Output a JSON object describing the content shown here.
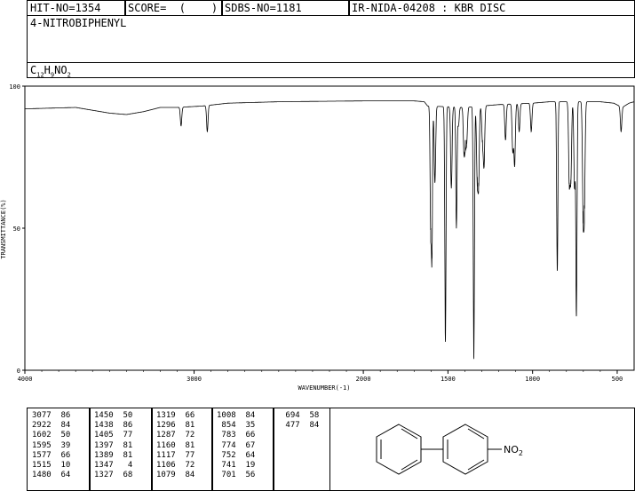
{
  "header": {
    "hit_no": "HIT-NO=1354",
    "score": "SCORE=  (    )",
    "sdbs_no": "SDBS-NO=1181",
    "ir": "IR-NIDA-04208 : KBR DISC",
    "compound": "4-NITROBIPHENYL",
    "formula_prefix": "C",
    "formula_sub1": "12",
    "formula_h": "H",
    "formula_sub2": "9",
    "formula_rest": "NO",
    "formula_sub3": "2"
  },
  "chart_data": {
    "type": "line",
    "xlabel": "WAVENUMBER(-1)",
    "ylabel": "TRANSMITTANCE(%)",
    "xlim": [
      4000,
      400
    ],
    "ylim": [
      0,
      100
    ],
    "x_ticks": [
      4000,
      3000,
      2000,
      1500,
      1000,
      500
    ],
    "y_ticks": [
      0,
      50,
      100
    ],
    "x_tick_labels": [
      "4000",
      "3000",
      "2000",
      "1500",
      "1000",
      "500"
    ],
    "y_tick_labels": [
      "0",
      "50",
      "100"
    ],
    "baseline": [
      [
        4000,
        92
      ],
      [
        3700,
        92.5
      ],
      [
        3500,
        90.5
      ],
      [
        3400,
        90
      ],
      [
        3300,
        91
      ],
      [
        3200,
        92.5
      ],
      [
        3100,
        92.5
      ],
      [
        2950,
        93
      ],
      [
        2800,
        94
      ],
      [
        2500,
        94.5
      ],
      [
        2000,
        94.8
      ],
      [
        1700,
        94.8
      ],
      [
        1640,
        94.5
      ],
      [
        1620,
        93
      ],
      [
        1400,
        92.5
      ],
      [
        1200,
        93.5
      ],
      [
        1000,
        94
      ],
      [
        900,
        94.5
      ],
      [
        800,
        94.5
      ],
      [
        700,
        94.5
      ],
      [
        600,
        94.5
      ],
      [
        520,
        94
      ],
      [
        470,
        92.5
      ],
      [
        430,
        94
      ],
      [
        400,
        94.5
      ]
    ],
    "peaks": [
      [
        3077,
        86
      ],
      [
        2922,
        84
      ],
      [
        1602,
        50
      ],
      [
        1595,
        39
      ],
      [
        1577,
        66
      ],
      [
        1515,
        10
      ],
      [
        1480,
        64
      ],
      [
        1450,
        50
      ],
      [
        1438,
        86
      ],
      [
        1405,
        77
      ],
      [
        1397,
        81
      ],
      [
        1389,
        81
      ],
      [
        1347,
        4
      ],
      [
        1327,
        68
      ],
      [
        1319,
        66
      ],
      [
        1296,
        81
      ],
      [
        1287,
        72
      ],
      [
        1160,
        81
      ],
      [
        1117,
        77
      ],
      [
        1106,
        72
      ],
      [
        1079,
        84
      ],
      [
        1008,
        84
      ],
      [
        854,
        35
      ],
      [
        783,
        66
      ],
      [
        774,
        67
      ],
      [
        752,
        64
      ],
      [
        741,
        19
      ],
      [
        701,
        56
      ],
      [
        694,
        58
      ],
      [
        477,
        84
      ]
    ],
    "peak_table": [
      [
        "3077  86",
        "2922  84",
        "1602  50",
        "1595  39",
        "1577  66",
        "1515  10",
        "1480  64"
      ],
      [
        "1450  50",
        "1438  86",
        "1405  77",
        "1397  81",
        "1389  81",
        "1347   4",
        "1327  68"
      ],
      [
        "1319  66",
        "1296  81",
        "1287  72",
        "1160  81",
        "1117  77",
        "1106  72",
        "1079  84"
      ],
      [
        "1008  84",
        " 854  35",
        " 783  66",
        " 774  67",
        " 752  64",
        " 741  19",
        " 701  56"
      ],
      [
        " 694  58",
        " 477  84"
      ]
    ],
    "structure_label": "NO",
    "structure_label_sub": "2"
  }
}
